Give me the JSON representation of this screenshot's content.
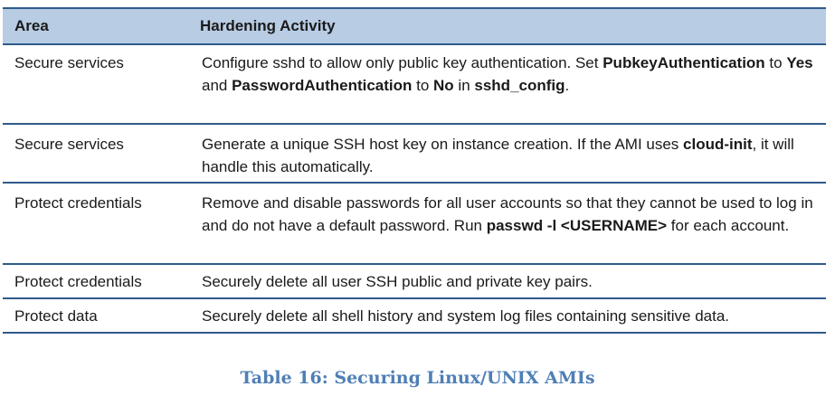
{
  "table": {
    "headers": {
      "area": "Area",
      "activity": "Hardening Activity"
    },
    "rows": [
      {
        "area": "Secure services",
        "activity": [
          {
            "t": "Configure sshd to allow only public key authentication. Set "
          },
          {
            "t": "PubkeyAuthentication",
            "b": true
          },
          {
            "t": " to "
          },
          {
            "t": "Yes",
            "b": true
          },
          {
            "t": " and "
          },
          {
            "t": "PasswordAuthentication",
            "b": true
          },
          {
            "t": " to "
          },
          {
            "t": "No",
            "b": true
          },
          {
            "t": " in "
          },
          {
            "t": "sshd_config",
            "b": true
          },
          {
            "t": "."
          }
        ]
      },
      {
        "area": "Secure services",
        "activity": [
          {
            "t": "Generate a unique SSH host key on instance creation. If the AMI uses "
          },
          {
            "t": "cloud-init",
            "b": true
          },
          {
            "t": ", it will handle this automatically."
          }
        ]
      },
      {
        "area": "Protect credentials",
        "activity": [
          {
            "t": "Remove and disable passwords for all user accounts so that they cannot be used to log in and do not have a default password. Run "
          },
          {
            "t": "passwd -l <USERNAME>",
            "b": true
          },
          {
            "t": " for each account."
          }
        ]
      },
      {
        "area": "Protect credentials",
        "activity": [
          {
            "t": "Securely delete all user SSH public and private key pairs."
          }
        ]
      },
      {
        "area": "Protect data",
        "activity": [
          {
            "t": "Securely delete all shell history and system log files containing sensitive data."
          }
        ]
      }
    ]
  },
  "caption": "Table 16: Securing Linux/UNIX AMIs",
  "colors": {
    "header_bg": "#b8cce4",
    "rule": "#2f5a8a",
    "caption": "#4f7fb5"
  }
}
